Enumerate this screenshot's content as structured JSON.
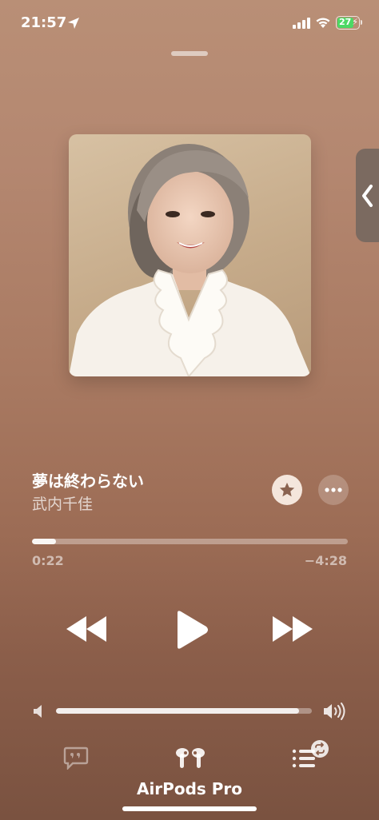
{
  "status_bar": {
    "time": "21:57",
    "battery_level": "27",
    "icons": [
      "location-arrow-icon",
      "signal-bars-icon",
      "wifi-icon",
      "battery-charging-icon"
    ],
    "battery_color": "#4cd964"
  },
  "now_playing": {
    "title": "夢は終わらない",
    "artist": "武内千佳",
    "elapsed": "0:22",
    "remaining": "−4:28",
    "progress_fraction": 0.075,
    "volume_fraction": 0.95,
    "artwork_description": "album-artwork"
  },
  "controls": {
    "favorite": "star-icon",
    "more": "ellipsis-icon",
    "previous": "backward-icon",
    "play": "play-icon",
    "next": "forward-icon",
    "volume_low": "speaker-low-icon",
    "volume_high": "speaker-high-icon"
  },
  "bottom_bar": {
    "device_name": "AirPods Pro",
    "items": [
      "lyrics-icon",
      "airpods-icon",
      "queue-icon"
    ]
  },
  "colors": {
    "background_top": "#b98f76",
    "background_bottom": "#7a5240",
    "star_button_bg": "#f4e6dc",
    "star_color": "#8a6350"
  }
}
